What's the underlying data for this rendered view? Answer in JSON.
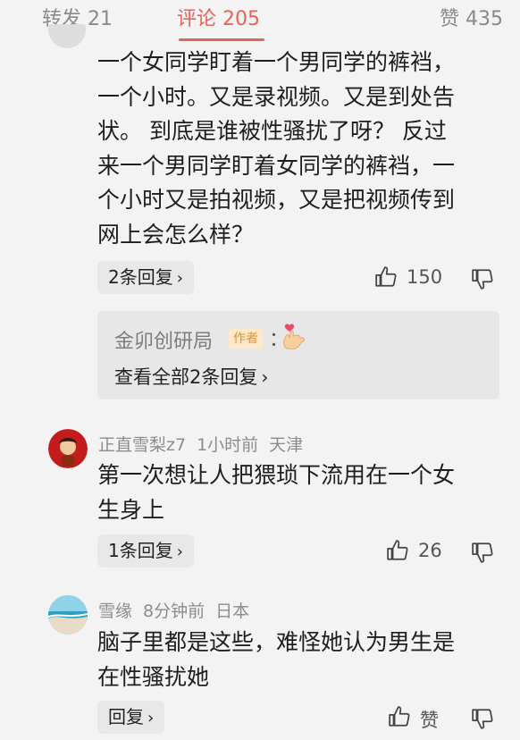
{
  "tabs": {
    "repost": "转发 21",
    "comments": "评论 205",
    "likes": "赞 435"
  },
  "comments": [
    {
      "lines": [
        "一个女同学盯着一个男同学的裤裆，",
        "一个小时。又是录视频。又是到处告",
        "状。 到底是谁被性骚扰了呀？ 反过",
        "来一个男同学盯着女同学的裤裆，一",
        "个小时又是拍视频，又是把视频传到",
        "网上会怎么样？"
      ],
      "replies_label": "2条回复",
      "like_count": "150",
      "sub_reply": {
        "name": "金卯创研局",
        "badge": "作者",
        "colon": "：",
        "view_all": "查看全部2条回复"
      }
    },
    {
      "username": "正直雪梨z7",
      "time": "1小时前",
      "location": "天津",
      "lines": [
        "第一次想让人把猥琐下流用在一个女",
        "生身上"
      ],
      "replies_label": "1条回复",
      "like_count": "26"
    },
    {
      "username": "雪缘",
      "time": "8分钟前",
      "location": "日本",
      "lines": [
        "脑子里都是这些，难怪她认为男生是",
        "在性骚扰她"
      ],
      "replies_label": "回复",
      "like_count": "赞"
    }
  ],
  "icons": {
    "chevron": "›",
    "like": "thumbs-up-icon",
    "dislike": "thumbs-down-icon"
  },
  "colors": {
    "accent": "#e8635a",
    "background": "#f3f3f3",
    "muted_text": "#8c8c8c"
  }
}
